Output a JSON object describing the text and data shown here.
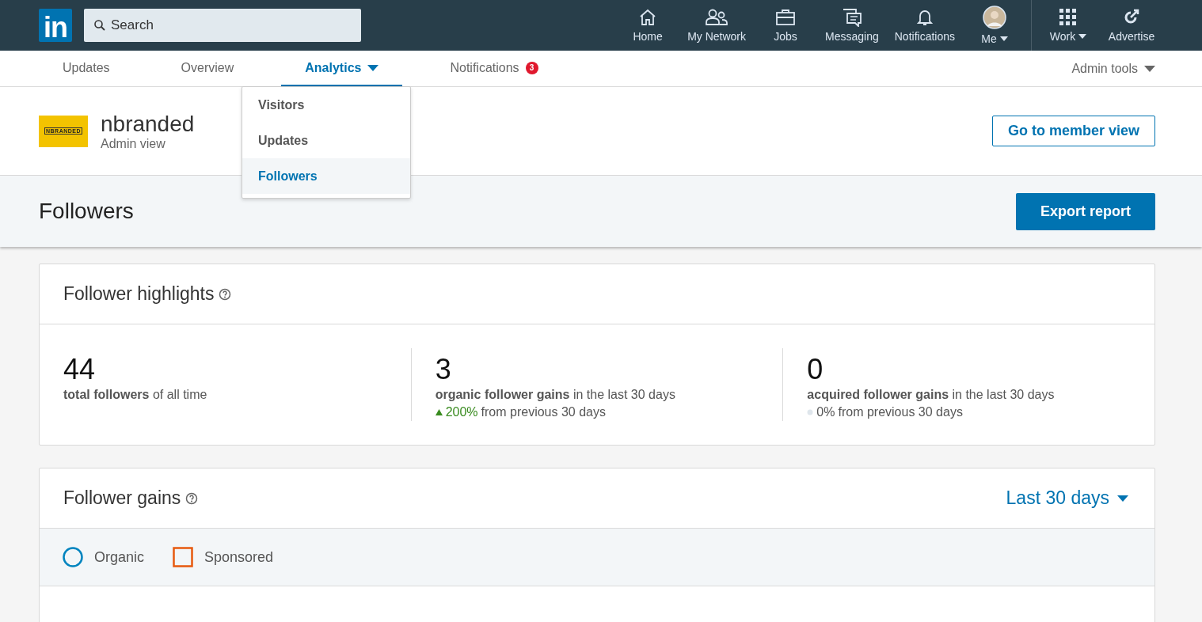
{
  "top_nav": {
    "logo": "in",
    "search": {
      "placeholder": "Search"
    },
    "items": [
      {
        "label": "Home",
        "kind": "home",
        "caret": false
      },
      {
        "label": "My Network",
        "kind": "network",
        "caret": false
      },
      {
        "label": "Jobs",
        "kind": "jobs",
        "caret": false
      },
      {
        "label": "Messaging",
        "kind": "messaging",
        "caret": false
      },
      {
        "label": "Notifications",
        "kind": "bell",
        "caret": false
      },
      {
        "label": "Me",
        "kind": "avatar",
        "caret": true
      }
    ],
    "extra_items": [
      {
        "label": "Work",
        "kind": "grid",
        "caret": true
      },
      {
        "label": "Advertise",
        "kind": "advertise",
        "caret": false
      }
    ]
  },
  "tabs": [
    {
      "label": "Updates",
      "selected": false
    },
    {
      "label": "Overview",
      "selected": false
    },
    {
      "label": "Analytics",
      "selected": true
    },
    {
      "label": "Notifications",
      "selected": false,
      "badge": "3"
    }
  ],
  "admin_tools": "Admin tools",
  "analytics_menu": [
    {
      "label": "Visitors",
      "selected": false
    },
    {
      "label": "Updates",
      "selected": false
    },
    {
      "label": "Followers",
      "selected": true
    }
  ],
  "company": {
    "logo_text": "NBRANDED",
    "name": "nbranded",
    "subtitle": "Admin view",
    "member_view_button": "Go to member view"
  },
  "page_title": "Followers",
  "export_button": "Export report",
  "highlights": {
    "title": "Follower highlights",
    "stats": [
      {
        "value": "44",
        "description": "**total followers** of all time"
      },
      {
        "value": "3",
        "description": "**organic follower gains** in the last 30 days",
        "change": {
          "kind": "up",
          "percent": "200%",
          "text": "from previous 30 days"
        }
      },
      {
        "value": "0",
        "description": "**acquired follower gains** in the last 30 days",
        "change": {
          "kind": "flat",
          "percent": "0%",
          "text": "from previous 30 days"
        }
      }
    ]
  },
  "gains": {
    "title": "Follower gains",
    "range": "Last 30 days",
    "legend": [
      {
        "label": "Organic",
        "kind": "circle",
        "color": "#0084bf"
      },
      {
        "label": "Sponsored",
        "kind": "square",
        "color": "#e7590e"
      }
    ]
  }
}
